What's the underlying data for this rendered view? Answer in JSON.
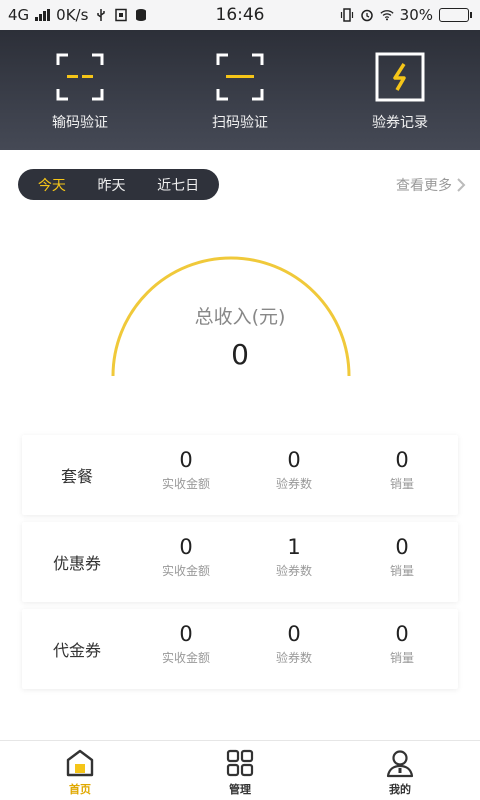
{
  "status_bar": {
    "network": "4G",
    "speed": "0K/s",
    "time": "16:46",
    "battery_percent": "30%",
    "battery_level": 0.3
  },
  "header": {
    "actions": [
      {
        "label": "输码验证",
        "icon": "code-verify-icon"
      },
      {
        "label": "扫码验证",
        "icon": "scan-verify-icon"
      },
      {
        "label": "验券记录",
        "icon": "voucher-record-icon"
      }
    ],
    "accent_color": "#f5c518"
  },
  "filters": {
    "tabs": [
      "今天",
      "昨天",
      "近七日"
    ],
    "active_index": 0,
    "more_label": "查看更多"
  },
  "summary": {
    "title": "总收入(元)",
    "value": "0"
  },
  "cards": [
    {
      "name": "套餐",
      "metrics": [
        {
          "value": "0",
          "label": "实收金额"
        },
        {
          "value": "0",
          "label": "验券数"
        },
        {
          "value": "0",
          "label": "销量"
        }
      ]
    },
    {
      "name": "优惠券",
      "metrics": [
        {
          "value": "0",
          "label": "实收金额"
        },
        {
          "value": "1",
          "label": "验券数"
        },
        {
          "value": "0",
          "label": "销量"
        }
      ]
    },
    {
      "name": "代金券",
      "metrics": [
        {
          "value": "0",
          "label": "实收金额"
        },
        {
          "value": "0",
          "label": "验券数"
        },
        {
          "value": "0",
          "label": "销量"
        }
      ]
    }
  ],
  "bottom_nav": {
    "items": [
      {
        "label": "首页",
        "icon": "home-icon"
      },
      {
        "label": "管理",
        "icon": "grid-icon"
      },
      {
        "label": "我的",
        "icon": "user-icon"
      }
    ],
    "active_index": 0
  }
}
